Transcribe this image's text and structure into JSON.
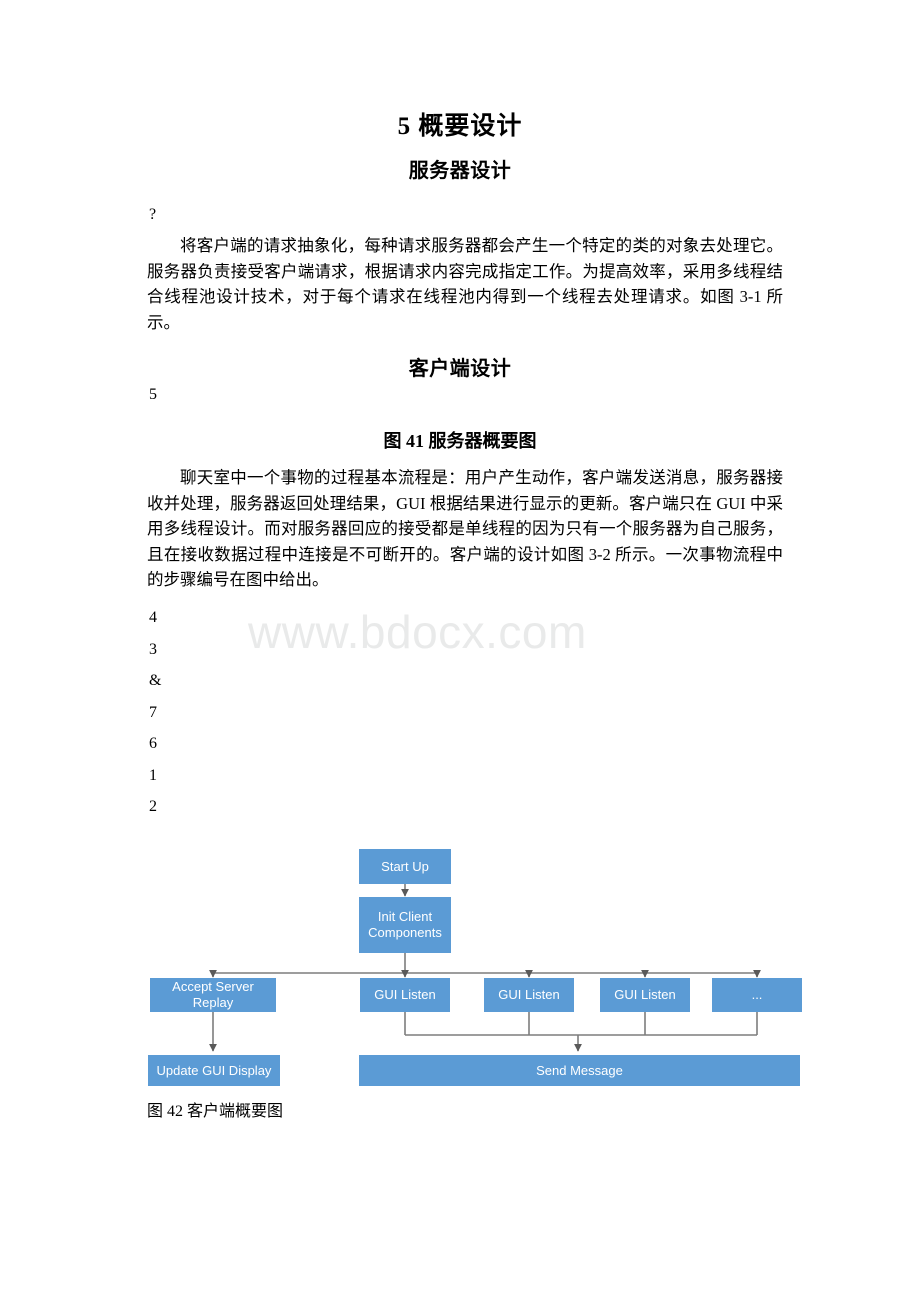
{
  "document": {
    "watermark": "www.bdocx.com",
    "heading_main": "5 概要设计",
    "section_server_title": "服务器设计",
    "section_client_title": "客户端设计",
    "stray_question_mark": "?",
    "stray_number_5": "5",
    "paragraph_server": "将客户端的请求抽象化，每种请求服务器都会产生一个特定的类的对象去处理它。服务器负责接受客户端请求，根据请求内容完成指定工作。为提高效率，采用多线程结合线程池设计技术，对于每个请求在线程池内得到一个线程去处理请求。如图 3-1 所示。",
    "figure_caption_41": "图 41 服务器概要图",
    "paragraph_client": "聊天室中一个事物的过程基本流程是：用户产生动作，客户端发送消息，服务器接收并处理，服务器返回处理结果，GUI 根据结果进行显示的更新。客户端只在 GUI 中采用多线程设计。而对服务器回应的接受都是单线程的因为只有一个服务器为自己服务，且在接收数据过程中连接是不可断开的。客户端的设计如图 3-2 所示。一次事物流程中的步骤编号在图中给出。",
    "step_numbers": [
      "4",
      "3",
      "&",
      "7",
      "6",
      "1",
      "2"
    ],
    "figure_caption_42": "图 42 客户端概要图"
  },
  "flowchart": {
    "node_color": "#5b9bd5",
    "connector_color": "#808080",
    "nodes": {
      "start_up": "Start Up",
      "init_client_components": "Init Client\nComponents",
      "accept_server_replay": "Accept Server\nReplay",
      "gui_listen_1": "GUI Listen",
      "gui_listen_2": "GUI Listen",
      "gui_listen_3": "GUI Listen",
      "more_ellipsis": "...",
      "update_gui_display": "Update GUI Display",
      "send_message": "Send Message"
    }
  }
}
